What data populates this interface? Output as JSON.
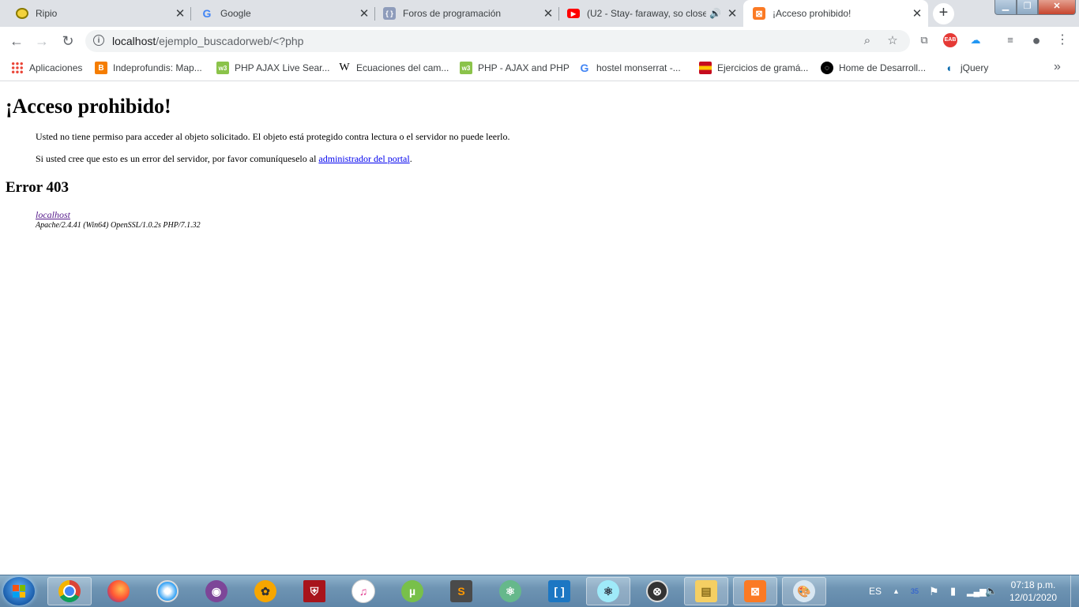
{
  "tabs": [
    {
      "title": "Ripio",
      "icon": "ripio-icon",
      "color": "#c8a800"
    },
    {
      "title": "Google",
      "icon": "google-icon",
      "color": "#4285f4"
    },
    {
      "title": "Foros de programación",
      "icon": "forum-icon",
      "color": "#7a8bb0"
    },
    {
      "title": "(U2 - Stay- faraway, so close",
      "icon": "youtube-icon",
      "color": "#ff0000"
    },
    {
      "title": "¡Acceso prohibido!",
      "icon": "xampp-icon",
      "color": "#fb7a24"
    }
  ],
  "toolbar": {
    "url_host": "localhost",
    "url_path": "/ejemplo_buscadorweb/<?php"
  },
  "bookmarks": [
    {
      "label": "Aplicaciones",
      "icon": "apps-grid-icon"
    },
    {
      "label": "Indeprofundis: Map...",
      "icon": "blogger-icon"
    },
    {
      "label": "PHP AJAX Live Sear...",
      "icon": "w3schools-icon"
    },
    {
      "label": "Ecuaciones del cam...",
      "icon": "wikipedia-icon"
    },
    {
      "label": "PHP - AJAX and PHP",
      "icon": "w3schools-icon"
    },
    {
      "label": "hostel monserrat -...",
      "icon": "google-icon"
    },
    {
      "label": "Ejercicios de gramá...",
      "icon": "flag-icon"
    },
    {
      "label": "Home de Desarroll...",
      "icon": "desarrollo-icon"
    },
    {
      "label": "jQuery",
      "icon": "jquery-icon"
    }
  ],
  "page": {
    "heading": "¡Acceso prohibido!",
    "para1": "Usted no tiene permiso para acceder al objeto solicitado. El objeto está protegido contra lectura o el servidor no puede leerlo.",
    "para2_before": "Si usted cree que esto es un error del servidor, por favor comuníqueselo al ",
    "para2_link": "administrador del portal",
    "para2_after": ".",
    "error_heading": "Error 403",
    "address_link": "localhost",
    "server_info": "Apache/2.4.41 (Win64) OpenSSL/1.0.2s PHP/7.1.32"
  },
  "taskbar": {
    "language": "ES",
    "time": "07:18 p.m.",
    "date": "12/01/2020"
  }
}
